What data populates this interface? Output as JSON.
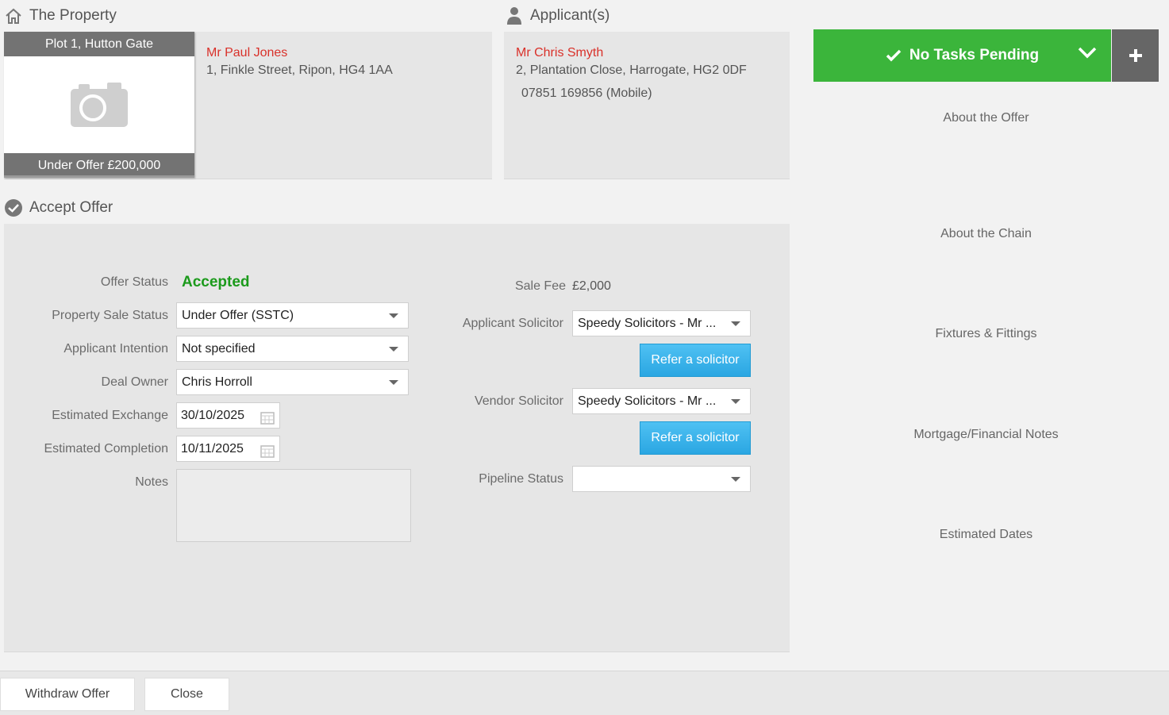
{
  "property": {
    "section_title": "The Property",
    "card_title": "Plot 1, Hutton Gate",
    "card_status": "Under Offer £200,000",
    "vendor_name": "Mr Paul Jones",
    "vendor_address": "1, Finkle Street, Ripon, HG4 1AA"
  },
  "applicants": {
    "section_title": "Applicant(s)",
    "name": "Mr Chris Smyth",
    "address": "2, Plantation Close, Harrogate, HG2 0DF",
    "phone": "07851 169856 (Mobile)"
  },
  "tasks": {
    "label": "No Tasks Pending",
    "color": "#3bb53b"
  },
  "sidebar": {
    "items": [
      {
        "label": "About the Offer"
      },
      {
        "label": "About the Chain"
      },
      {
        "label": "Fixtures & Fittings"
      },
      {
        "label": "Mortgage/Financial Notes"
      },
      {
        "label": "Estimated Dates"
      }
    ]
  },
  "accept_offer": {
    "section_title": "Accept Offer",
    "offer_status_label": "Offer Status",
    "offer_status_value": "Accepted",
    "property_sale_status_label": "Property Sale Status",
    "property_sale_status_value": "Under Offer (SSTC)",
    "applicant_intention_label": "Applicant Intention",
    "applicant_intention_value": "Not specified",
    "deal_owner_label": "Deal Owner",
    "deal_owner_value": "Chris Horroll",
    "estimated_exchange_label": "Estimated Exchange",
    "estimated_exchange_value": "30/10/2025",
    "estimated_completion_label": "Estimated Completion",
    "estimated_completion_value": "10/11/2025",
    "notes_label": "Notes",
    "sale_fee_label": "Sale Fee",
    "sale_fee_value": "£2,000",
    "applicant_solicitor_label": "Applicant Solicitor",
    "applicant_solicitor_value": "Speedy Solicitors - Mr ...",
    "refer_solicitor_label": "Refer a solicitor",
    "vendor_solicitor_label": "Vendor Solicitor",
    "vendor_solicitor_value": "Speedy Solicitors - Mr ...",
    "pipeline_status_label": "Pipeline Status",
    "pipeline_status_value": ""
  },
  "footer": {
    "withdraw_label": "Withdraw Offer",
    "close_label": "Close"
  }
}
